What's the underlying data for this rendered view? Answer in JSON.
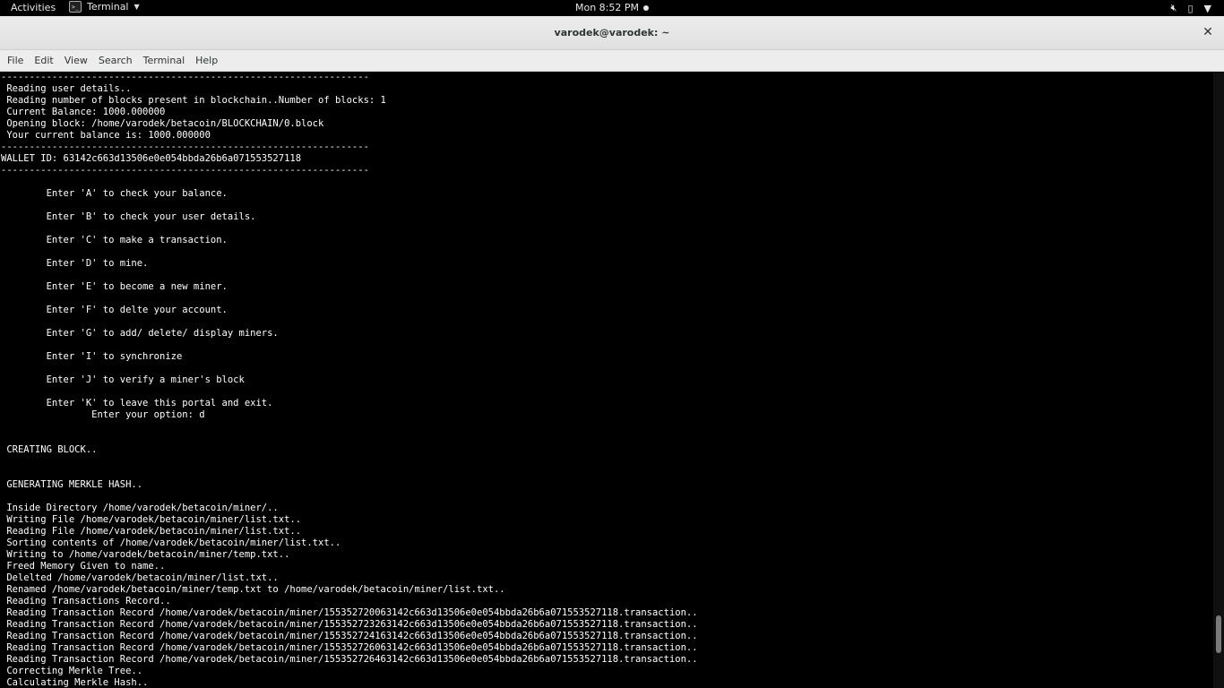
{
  "topbar": {
    "activities": "Activities",
    "app_name": "Terminal",
    "app_icon": "terminal-icon",
    "clock": "Mon  8:52 PM",
    "tray_icons": [
      "volume-muted-icon",
      "battery-icon",
      "system-menu-caret-icon"
    ]
  },
  "window": {
    "title": "varodek@varodek: ~",
    "close_symbol": "✕"
  },
  "menubar": {
    "items": [
      "File",
      "Edit",
      "View",
      "Search",
      "Terminal",
      "Help"
    ]
  },
  "terminal": {
    "scroll_position": 0.94,
    "lines": [
      "-----------------------------------------------------------------",
      " Reading user details..",
      " Reading number of blocks present in blockchain..Number of blocks: 1",
      " Current Balance: 1000.000000",
      " Opening block: /home/varodek/betacoin/BLOCKCHAIN/0.block",
      " Your current balance is: 1000.000000",
      "-----------------------------------------------------------------",
      "WALLET ID: 63142c663d13506e0e054bbda26b6a071553527118",
      "-----------------------------------------------------------------",
      "",
      "        Enter 'A' to check your balance.",
      "",
      "        Enter 'B' to check your user details.",
      "",
      "        Enter 'C' to make a transaction.",
      "",
      "        Enter 'D' to mine.",
      "",
      "        Enter 'E' to become a new miner.",
      "",
      "        Enter 'F' to delte your account.",
      "",
      "        Enter 'G' to add/ delete/ display miners.",
      "",
      "        Enter 'I' to synchronize",
      "",
      "        Enter 'J' to verify a miner's block",
      "",
      "        Enter 'K' to leave this portal and exit.",
      "                Enter your option: d",
      "",
      "",
      " CREATING BLOCK..",
      "",
      "",
      " GENERATING MERKLE HASH..",
      "",
      " Inside Directory /home/varodek/betacoin/miner/..",
      " Writing File /home/varodek/betacoin/miner/list.txt..",
      " Reading File /home/varodek/betacoin/miner/list.txt..",
      " Sorting contents of /home/varodek/betacoin/miner/list.txt..",
      " Writing to /home/varodek/betacoin/miner/temp.txt..",
      " Freed Memory Given to name..",
      " Delelted /home/varodek/betacoin/miner/list.txt..",
      " Renamed /home/varodek/betacoin/miner/temp.txt to /home/varodek/betacoin/miner/list.txt..",
      " Reading Transactions Record..",
      " Reading Transaction Record /home/varodek/betacoin/miner/155352720063142c663d13506e0e054bbda26b6a071553527118.transaction..",
      " Reading Transaction Record /home/varodek/betacoin/miner/155352723263142c663d13506e0e054bbda26b6a071553527118.transaction..",
      " Reading Transaction Record /home/varodek/betacoin/miner/155352724163142c663d13506e0e054bbda26b6a071553527118.transaction..",
      " Reading Transaction Record /home/varodek/betacoin/miner/155352726063142c663d13506e0e054bbda26b6a071553527118.transaction..",
      " Reading Transaction Record /home/varodek/betacoin/miner/155352726463142c663d13506e0e054bbda26b6a071553527118.transaction..",
      " Correcting Merkle Tree..",
      " Calculating Merkle Hash.."
    ]
  }
}
